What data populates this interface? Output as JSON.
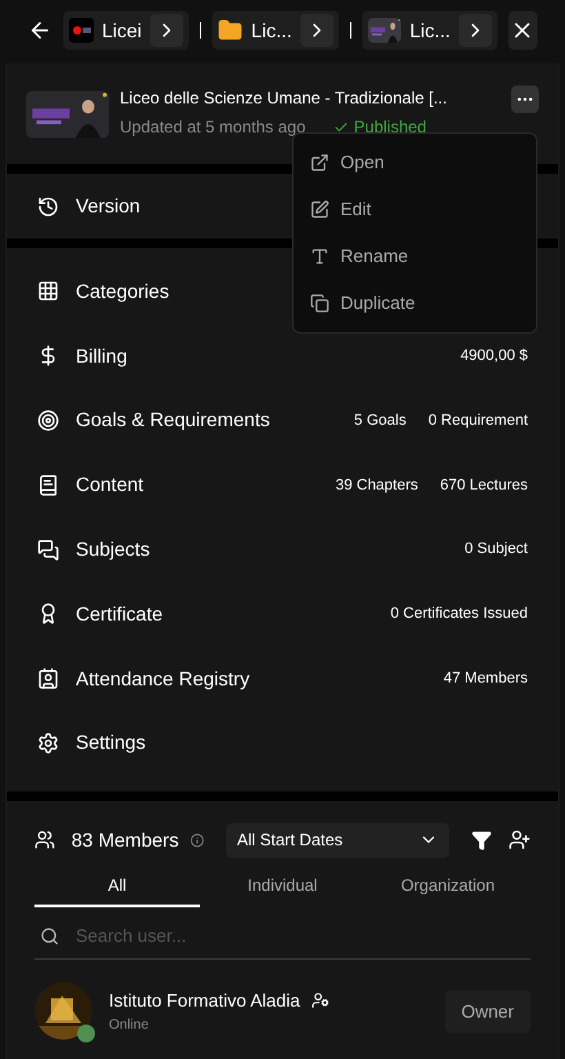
{
  "breadcrumbs": [
    {
      "kind": "app",
      "label": "Licei"
    },
    {
      "kind": "folder",
      "label": "Lic..."
    },
    {
      "kind": "picture",
      "label": "Lic..."
    }
  ],
  "course": {
    "title": "Liceo delle Scienze Umane - Tradizionale [...",
    "updated": "Updated at 5 months ago",
    "status": "Published"
  },
  "menu": {
    "open": true,
    "items": [
      "Open",
      "Edit",
      "Rename",
      "Duplicate"
    ]
  },
  "version": "Version",
  "sections": [
    {
      "label": "Categories"
    },
    {
      "label": "Billing",
      "stats": [
        "4900,00 $"
      ]
    },
    {
      "label": "Goals & Requirements",
      "stats": [
        "5 Goals",
        "0 Requirement"
      ]
    },
    {
      "label": "Content",
      "stats": [
        "39 Chapters",
        "670 Lectures"
      ]
    },
    {
      "label": "Subjects",
      "stats": [
        "0 Subject"
      ]
    },
    {
      "label": "Certificate",
      "stats": [
        "0 Certificates Issued"
      ]
    },
    {
      "label": "Attendance Registry",
      "stats": [
        "47 Members"
      ]
    },
    {
      "label": "Settings"
    }
  ],
  "members": {
    "count": "83 Members",
    "filter": "All Start Dates",
    "tabs": [
      {
        "label": "All",
        "selected": true
      },
      {
        "label": "Individual",
        "selected": false
      },
      {
        "label": "Organization",
        "selected": false
      }
    ],
    "search": {
      "placeholder": "Search user..."
    },
    "list": [
      {
        "name": "Istituto Formativo Aladia",
        "status": "Online",
        "online": true,
        "role": "Owner"
      }
    ]
  }
}
